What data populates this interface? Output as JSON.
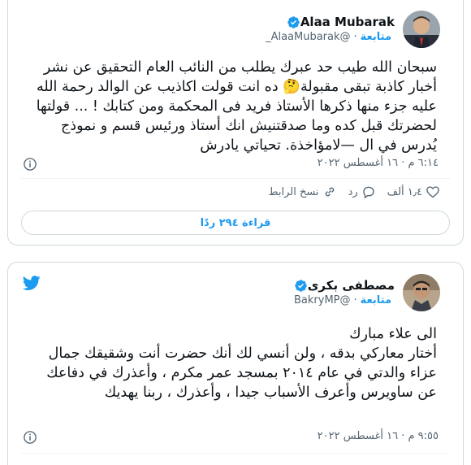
{
  "tweets": [
    {
      "display_name": "Alaa Mubarak",
      "handle": "@AlaaMubarak_",
      "follow_label": "متابعة",
      "text": "سبحان الله طيب حد عبرك يطلب من النائب العام التحقيق عن نشر أخبار كاذبة تبقى مقبولة🤔 ده انت قولت اكاذيب عن الوالد رحمة الله عليه جزء منها ذكرها الأستاذ فريد فى المحكمة ومن كتابك ! ... قولتها لحضرتك قبل كده وما صدقتنيش انك أستاذ ورئيس قسم و نموذج يُدرس في ال —لامؤاخذة. تحياتي يادرش",
      "timestamp": "٦:١٤ م · ١٦ أغسطس ٢٠٢٢",
      "like_count": "١٫٤ ألف",
      "reply_label": "رد",
      "copy_link_label": "نسخ الرابط",
      "read_replies_label": "قراءة ٢٩٤ ردًا"
    },
    {
      "display_name": "مصطفى بكرى",
      "handle": "@BakryMP",
      "follow_label": "متابعة",
      "text": "الى علاء مبارك\nأختار معاركي بدقه ، ولن أنسي لك أنك حضرت أنت وشقيقك جمال عزاء والدتي في عام ٢٠١٤ بمسجد عمر مكرم ، وأعذرك في دفاعك عن ساويرس وأعرف الأسباب جيدا ، وأعذرك ، ربنا يهديك",
      "timestamp": "٩:٥٥ م · ١٦ أغسطس ٢٠٢٢"
    }
  ],
  "colors": {
    "accent": "#1d9bf0",
    "secondary_text": "#536471",
    "border": "#cfd9de"
  },
  "icons": [
    "verified-badge-icon",
    "info-icon",
    "heart-icon",
    "reply-icon",
    "link-icon",
    "twitter-bird-icon"
  ]
}
